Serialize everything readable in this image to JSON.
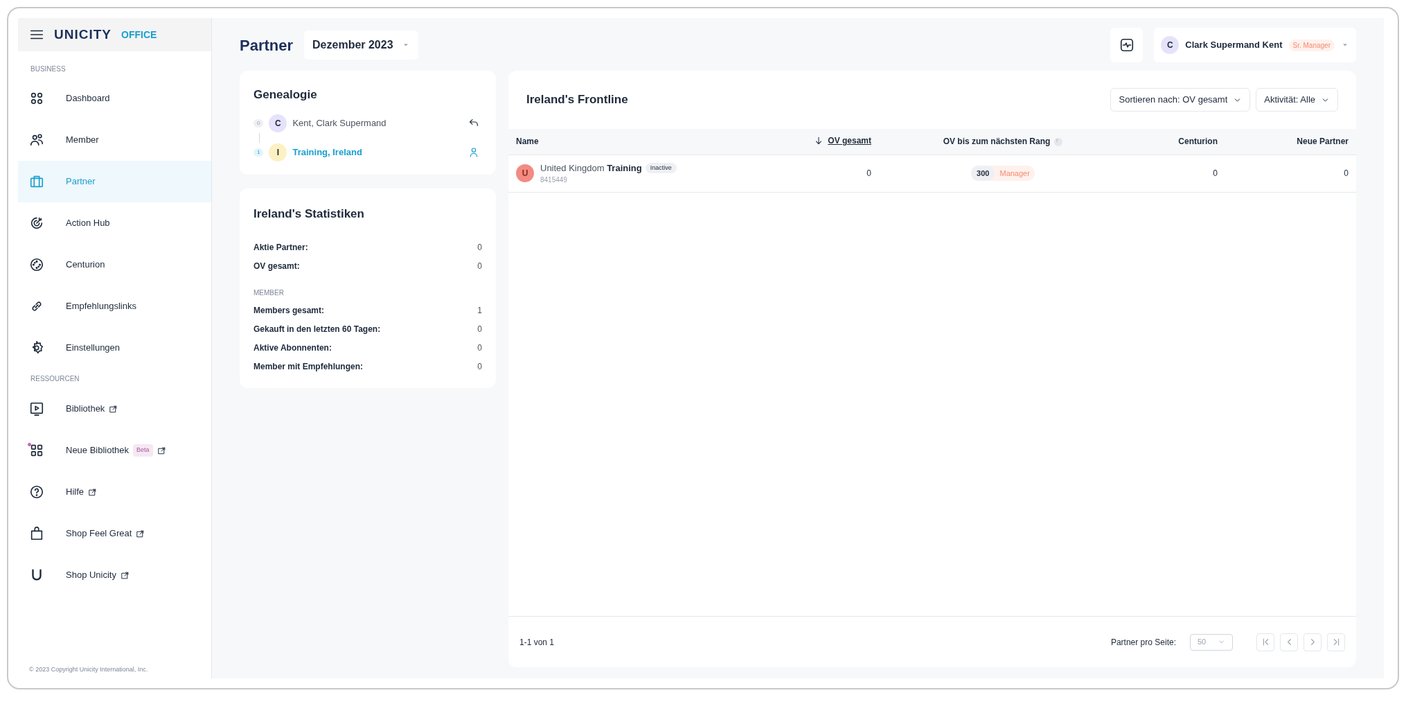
{
  "sidebar": {
    "logo": {
      "brand": "UNICITY",
      "product": "OFFICE"
    },
    "sections": [
      {
        "title": "BUSINESS",
        "items": [
          {
            "kind": "dashboard",
            "label": "Dashboard",
            "selected": false,
            "external": false
          },
          {
            "kind": "members",
            "label": "Member",
            "selected": false,
            "external": false
          },
          {
            "kind": "briefcase",
            "label": "Partner",
            "selected": true,
            "external": false
          },
          {
            "kind": "target",
            "label": "Action Hub",
            "selected": false,
            "external": false
          },
          {
            "kind": "dial",
            "label": "Centurion",
            "selected": false,
            "external": false
          },
          {
            "kind": "link",
            "label": "Empfehlungslinks",
            "selected": false,
            "external": false
          },
          {
            "kind": "gear",
            "label": "Einstellungen",
            "selected": false,
            "external": false
          }
        ]
      },
      {
        "title": "RESSOURCEN",
        "items": [
          {
            "kind": "play",
            "label": "Bibliothek",
            "selected": false,
            "external": true
          },
          {
            "kind": "grid",
            "label": "Neue Bibliothek",
            "badge": "Beta",
            "notification": true,
            "selected": false,
            "external": true
          },
          {
            "kind": "help",
            "label": "Hilfe",
            "selected": false,
            "external": true
          },
          {
            "kind": "bag",
            "label": "Shop Feel Great",
            "selected": false,
            "external": true
          },
          {
            "kind": "u",
            "label": "Shop Unicity",
            "selected": false,
            "external": true
          }
        ]
      }
    ],
    "copyright": "© 2023 Copyright Unicity International, Inc."
  },
  "header": {
    "title": "Partner",
    "period": "Dezember 2023",
    "user": {
      "initial": "C",
      "name": "Clark Supermand Kent",
      "rank": "Sr. Manager"
    }
  },
  "genealogy": {
    "title": "Genealogie",
    "nodes": [
      {
        "level": "0",
        "initial": "C",
        "name": "Kent, Clark Supermand",
        "selected": false,
        "color": "#e6e2fb"
      },
      {
        "level": "1",
        "initial": "I",
        "name": "Training, Ireland",
        "selected": true,
        "color": "#fdf0c2"
      }
    ]
  },
  "statistics": {
    "title": "Ireland's Statistiken",
    "rows": [
      {
        "label": "Aktie Partner:",
        "value": "0"
      },
      {
        "label": "OV gesamt:",
        "value": "0"
      }
    ],
    "member_title": "MEMBER",
    "member_rows": [
      {
        "label": "Members gesamt:",
        "value": "1"
      },
      {
        "label": "Gekauft in den letzten 60 Tagen:",
        "value": "0"
      },
      {
        "label": "Aktive Abonnenten:",
        "value": "0"
      },
      {
        "label": "Member mit Empfehlungen:",
        "value": "0"
      }
    ]
  },
  "frontline": {
    "title": "Ireland's Frontline",
    "sort": "Sortieren nach: OV gesamt",
    "activity": "Aktivität: Alle",
    "columns": [
      "Name",
      "OV gesamt",
      "OV bis zum nächsten Rang",
      "Centurion",
      "Neue Partner"
    ],
    "rows": [
      {
        "initial": "U",
        "name": "United Kingdom",
        "name_bold": "Training",
        "status": "Inactive",
        "id": "8415449",
        "ov": "0",
        "next_ov": "300",
        "next_rank": "Manager",
        "centurion": "0",
        "new_partners": "0"
      }
    ],
    "pagination": {
      "range": "1-1 von 1",
      "per_page_label": "Partner pro Seite:",
      "per_page": "50"
    }
  }
}
